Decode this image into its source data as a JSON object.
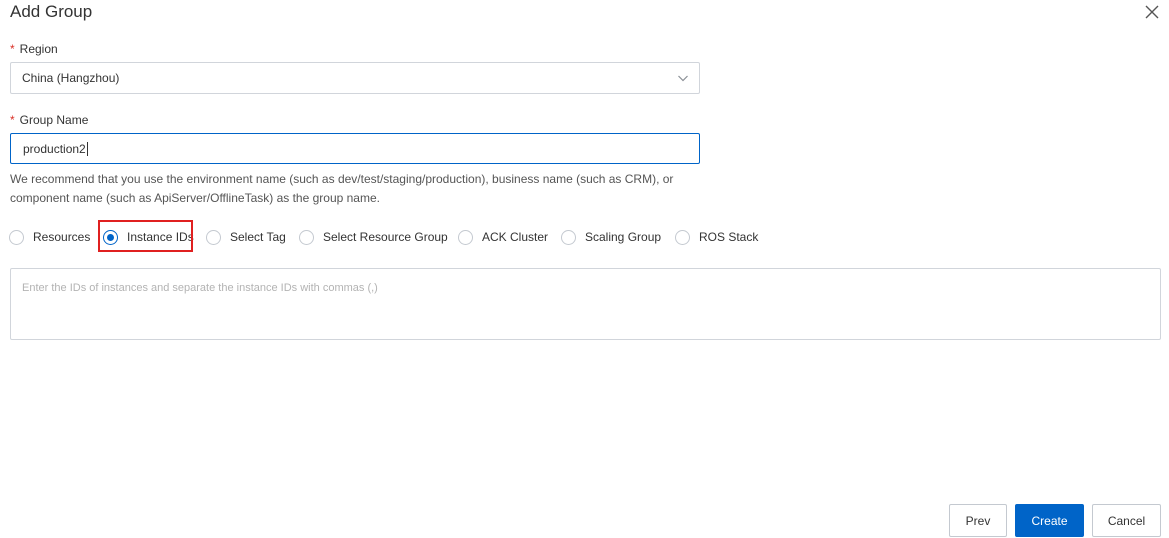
{
  "dialog": {
    "title": "Add Group"
  },
  "region": {
    "label": "Region",
    "value": "China (Hangzhou)"
  },
  "group_name": {
    "label": "Group Name",
    "value": "production2",
    "hint": "We recommend that you use the environment name (such as dev/test/staging/production), business name (such as CRM), or component name (such as ApiServer/OfflineTask) as the group name."
  },
  "radios": [
    {
      "label": "Resources",
      "checked": false
    },
    {
      "label": "Instance IDs",
      "checked": true
    },
    {
      "label": "Select Tag",
      "checked": false
    },
    {
      "label": "Select Resource Group",
      "checked": false
    },
    {
      "label": "ACK Cluster",
      "checked": false
    },
    {
      "label": "Scaling Group",
      "checked": false
    },
    {
      "label": "ROS Stack",
      "checked": false
    }
  ],
  "instances": {
    "placeholder": "Enter the IDs of instances and separate the instance IDs with commas (,)"
  },
  "footer": {
    "prev_label": "Prev",
    "create_label": "Create",
    "cancel_label": "Cancel"
  },
  "colors": {
    "primary": "#0064c8",
    "required": "#d93026",
    "highlight": "#e02020"
  }
}
